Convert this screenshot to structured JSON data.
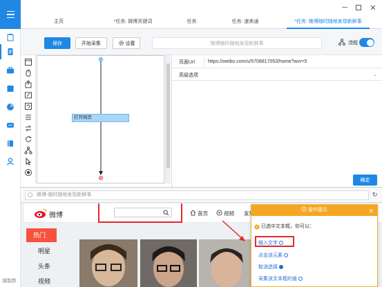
{
  "sidebar": {
    "footer": "谋能新"
  },
  "tabs": [
    {
      "label": "主页"
    },
    {
      "label": "*任务: 微博关键词"
    },
    {
      "label": "任务"
    },
    {
      "label": "任务: 速卖通"
    },
    {
      "label": "*任务: 微博随时随地发现新鲜事"
    }
  ],
  "toolbar": {
    "save_label": "保存",
    "collect_label": "开始采集",
    "settings_label": "设置",
    "task_name": "微博随时随地发现新鲜事",
    "flow_label": "流程"
  },
  "canvas": {
    "node_label": "打开网页"
  },
  "panel": {
    "url_label": "页面Url",
    "url_value": "https://weibo.com/u/5708817053/home?wvr=5",
    "advanced_label": "高级选项",
    "confirm_label": "确定"
  },
  "browser": {
    "address": "微博-随时随地发现新鲜事",
    "nav": {
      "logo": "微博",
      "home": "首页",
      "video": "视频",
      "discover": "发现"
    },
    "categories": [
      "热门",
      "明星",
      "头条",
      "视频"
    ]
  },
  "popup": {
    "title": "操作提示",
    "message": "已选中文本框，你可以：",
    "actions": [
      "输入文字",
      "点击该元素",
      "取消选择",
      "采集该文本框的值"
    ]
  },
  "colors": {
    "accent": "#1f88e5",
    "popup_header": "#f5a623",
    "highlight": "#e0292a",
    "hot": "#f8523d"
  }
}
